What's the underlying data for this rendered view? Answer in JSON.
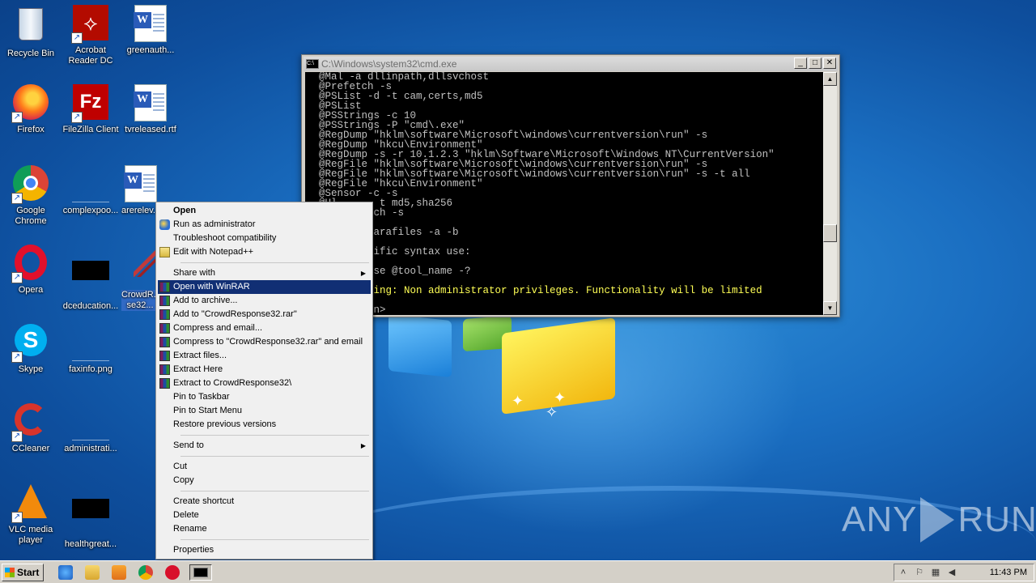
{
  "desktop": {
    "icons": [
      {
        "label": "Recycle Bin"
      },
      {
        "label": "Acrobat Reader DC"
      },
      {
        "label": "greenauth..."
      },
      {
        "label": "Firefox"
      },
      {
        "label": "FileZilla Client"
      },
      {
        "label": "tvreleased.rtf"
      },
      {
        "label": "Google Chrome"
      },
      {
        "label": "complexpoo..."
      },
      {
        "label": "arerelev..."
      },
      {
        "label": "Opera"
      },
      {
        "label": "dceducation..."
      },
      {
        "label": "CrowdR..."
      },
      {
        "label": "se32..."
      },
      {
        "label": "Skype"
      },
      {
        "label": "faxinfo.png"
      },
      {
        "label": "CCleaner"
      },
      {
        "label": "administrati..."
      },
      {
        "label": "VLC media player"
      },
      {
        "label": "healthgreat..."
      }
    ]
  },
  "cmd": {
    "title": "C:\\Windows\\system32\\cmd.exe",
    "lines": [
      {
        "text": "@Mal -a dllinpath,dllsvchost",
        "color": "#c0c0c0"
      },
      {
        "text": "@Prefetch -s",
        "color": "#c0c0c0"
      },
      {
        "text": "@PSList -d -t cam,certs,md5",
        "color": "#c0c0c0"
      },
      {
        "text": "@PSList",
        "color": "#c0c0c0"
      },
      {
        "text": "@PSStrings -c 10",
        "color": "#c0c0c0"
      },
      {
        "text": "@PSStrings -P \"cmd\\.exe\"",
        "color": "#c0c0c0"
      },
      {
        "text": "@RegDump \"hklm\\software\\Microsoft\\windows\\currentversion\\run\" -s",
        "color": "#c0c0c0"
      },
      {
        "text": "@RegDump \"hkcu\\Environment\"",
        "color": "#c0c0c0"
      },
      {
        "text": "@RegDump -s -r 10.1.2.3 \"hklm\\Software\\Microsoft\\Windows NT\\CurrentVersion\"",
        "color": "#c0c0c0"
      },
      {
        "text": "@RegFile \"hklm\\software\\Microsoft\\windows\\currentversion\\run\" -s",
        "color": "#c0c0c0"
      },
      {
        "text": "@RegFile \"hklm\\software\\Microsoft\\windows\\currentversion\\run\" -s -t all",
        "color": "#c0c0c0"
      },
      {
        "text": "@RegFile \"hkcu\\Environment\"",
        "color": "#c0c0c0"
      },
      {
        "text": "@Sensor -c -s",
        "color": "#c0c0c0"
      },
      {
        "text": "@Ul       t md5,sha256",
        "color": "#c0c0c0"
      },
      {
        "text": "        tch -s",
        "color": "#c0c0c0"
      },
      {
        "text": "",
        "color": "#c0c0c0"
      },
      {
        "text": "        yarafiles -a -b",
        "color": "#c0c0c0"
      },
      {
        "text": "",
        "color": "#c0c0c0"
      },
      {
        "text": "      pecific syntax use:",
        "color": "#c0c0c0"
      },
      {
        "text": "",
        "color": "#c0c0c0"
      },
      {
        "text": "      ponse @tool_name -?",
        "color": "#c0c0c0"
      },
      {
        "text": "",
        "color": "#c0c0c0"
      },
      {
        "text": "     Warning: Non administrator privileges. Functionality will be limited",
        "color": "#ffff55"
      },
      {
        "text": "",
        "color": "#c0c0c0"
      },
      {
        "text": "      dmin>",
        "color": "#c0c0c0"
      }
    ]
  },
  "context_menu": {
    "items": [
      {
        "label": "Open",
        "bold": true
      },
      {
        "label": "Run as administrator",
        "icon": "shield-icon"
      },
      {
        "label": "Troubleshoot compatibility"
      },
      {
        "label": "Edit with Notepad++",
        "icon": "notepad-icon"
      },
      {
        "sep": true
      },
      {
        "label": "Share with",
        "submenu": true
      },
      {
        "label": "Open with WinRAR",
        "icon": "winrar-icon",
        "highlight": true
      },
      {
        "label": "Add to archive...",
        "icon": "winrar-icon"
      },
      {
        "label": "Add to \"CrowdResponse32.rar\"",
        "icon": "winrar-icon"
      },
      {
        "label": "Compress and email...",
        "icon": "winrar-icon"
      },
      {
        "label": "Compress to \"CrowdResponse32.rar\" and email",
        "icon": "winrar-icon"
      },
      {
        "label": "Extract files...",
        "icon": "winrar-icon"
      },
      {
        "label": "Extract Here",
        "icon": "winrar-icon"
      },
      {
        "label": "Extract to CrowdResponse32\\",
        "icon": "winrar-icon"
      },
      {
        "label": "Pin to Taskbar"
      },
      {
        "label": "Pin to Start Menu"
      },
      {
        "label": "Restore previous versions"
      },
      {
        "sep": true
      },
      {
        "label": "Send to",
        "submenu": true
      },
      {
        "sep": true
      },
      {
        "label": "Cut"
      },
      {
        "label": "Copy"
      },
      {
        "sep": true
      },
      {
        "label": "Create shortcut"
      },
      {
        "label": "Delete"
      },
      {
        "label": "Rename"
      },
      {
        "sep": true
      },
      {
        "label": "Properties"
      }
    ],
    "highlight_color": "#112f74"
  },
  "taskbar": {
    "start_label": "Start",
    "clock": "11:43 PM"
  },
  "watermark": {
    "left": "ANY",
    "right": "RUN"
  }
}
